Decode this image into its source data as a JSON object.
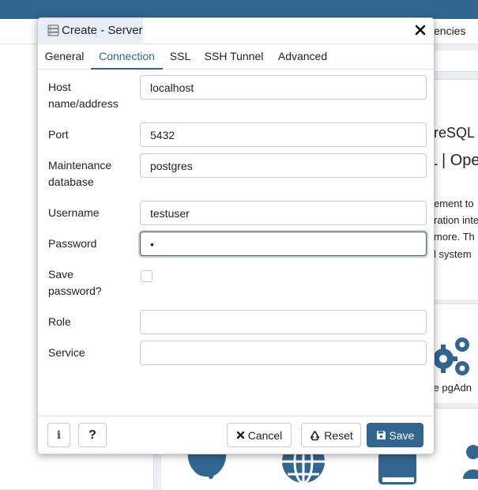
{
  "background": {
    "tab_fragment": "encies",
    "title_fragment": "reSQL",
    "subtitle_fragment": "L | Ope",
    "paragraph_lines": [
      "ement to",
      "ration inte",
      "more. Th",
      "l system"
    ],
    "gear_caption": "ure pgAdn"
  },
  "dialog": {
    "title": "Create - Server",
    "tabs": [
      {
        "label": "General"
      },
      {
        "label": "Connection"
      },
      {
        "label": "SSL"
      },
      {
        "label": "SSH Tunnel"
      },
      {
        "label": "Advanced"
      }
    ],
    "active_tab": "Connection",
    "fields": {
      "host": {
        "label_line1": "Host",
        "label_line2": "name/address",
        "value": "localhost"
      },
      "port": {
        "label": "Port",
        "value": "5432"
      },
      "maintenance_db": {
        "label_line1": "Maintenance",
        "label_line2": "database",
        "value": "postgres"
      },
      "username": {
        "label": "Username",
        "value": "testuser"
      },
      "password": {
        "label": "Password",
        "value": "•"
      },
      "save_password": {
        "label_line1": "Save",
        "label_line2": "password?",
        "checked": false
      },
      "role": {
        "label": "Role",
        "value": ""
      },
      "service": {
        "label": "Service",
        "value": ""
      }
    },
    "footer": {
      "info_label": "i",
      "help_label": "?",
      "cancel_label": "Cancel",
      "reset_label": "Reset",
      "save_label": "Save"
    }
  },
  "colors": {
    "primary": "#326690",
    "active_tab": "#326690",
    "title_bg": "#e8eef8"
  }
}
